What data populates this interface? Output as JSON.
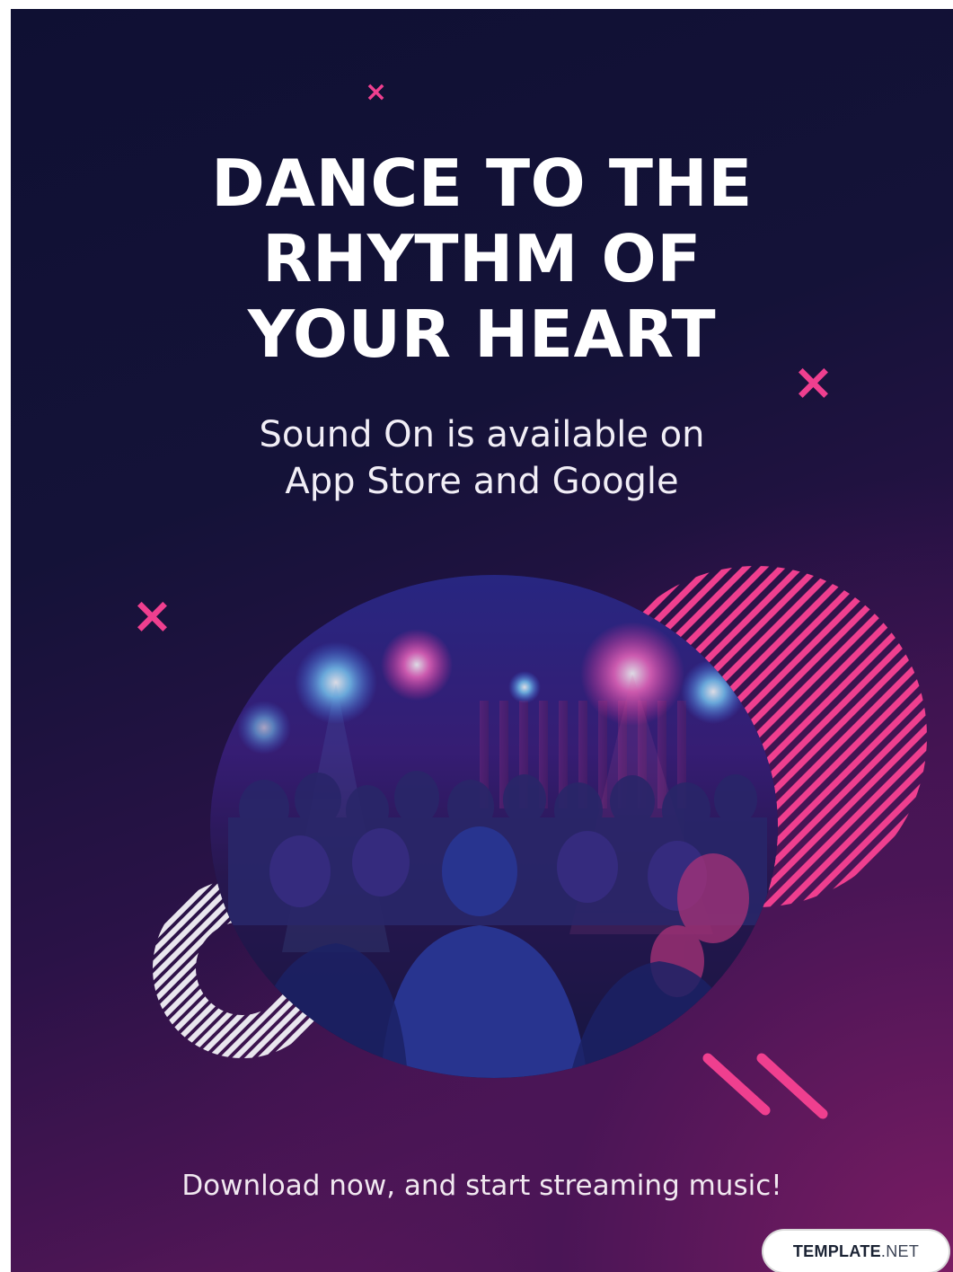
{
  "headline": {
    "lines": [
      "DANCE TO THE",
      "RHYTHM OF",
      "YOUR HEART"
    ]
  },
  "subheadline": {
    "lines": [
      "Sound On is available on",
      "App Store and Google"
    ]
  },
  "footer": {
    "text": "Download now, and start streaming music!"
  },
  "watermark": {
    "brand": "TEMPLATE",
    "suffix": ".NET"
  },
  "decorations": {
    "cross_glyph": "×",
    "accent_color": "#ef3f8f",
    "light_stripe_color": "#e9e6ee"
  },
  "colors": {
    "background_top": "#0f1033",
    "background_bottom": "#7b1d63",
    "headline": "#ffffff"
  },
  "image": {
    "subject": "crowd dancing at a concert under pink and blue stage lights"
  }
}
